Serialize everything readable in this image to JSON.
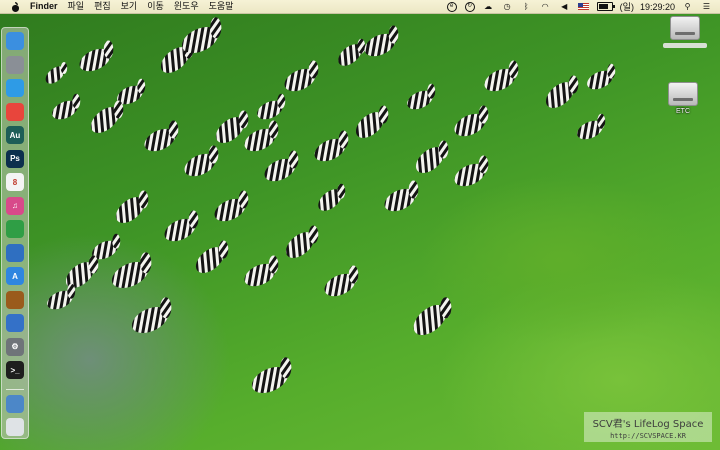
{
  "menubar": {
    "app_name": "Finder",
    "items": [
      "파일",
      "편집",
      "보기",
      "이동",
      "윈도우",
      "도움말"
    ],
    "status": {
      "day": "(일)",
      "time": "19:29:20"
    }
  },
  "desktop": {
    "icons": [
      {
        "label": ""
      },
      {
        "label": "ETC"
      }
    ]
  },
  "dock": {
    "apps": [
      {
        "name": "finder-icon",
        "glyph": "",
        "color": "#3b8fe0"
      },
      {
        "name": "launchpad-icon",
        "glyph": "",
        "color": "#8a8f96"
      },
      {
        "name": "safari-icon",
        "glyph": "",
        "color": "#2e9be6"
      },
      {
        "name": "chrome-icon",
        "glyph": "",
        "color": "#e8453c"
      },
      {
        "name": "audition-icon",
        "glyph": "Au",
        "color": "#1d5e57"
      },
      {
        "name": "photoshop-icon",
        "glyph": "Ps",
        "color": "#0c2f4d"
      },
      {
        "name": "calendar-icon",
        "glyph": "8",
        "color": "#f4f4f4"
      },
      {
        "name": "itunes-icon",
        "glyph": "♫",
        "color": "#d84a8a"
      },
      {
        "name": "evernote-icon",
        "glyph": "",
        "color": "#2f9e45"
      },
      {
        "name": "automator-icon",
        "glyph": "",
        "color": "#2f6fc1"
      },
      {
        "name": "appstore-icon",
        "glyph": "A",
        "color": "#2f86e0"
      },
      {
        "name": "speaker-icon",
        "glyph": "",
        "color": "#9a5b1c"
      },
      {
        "name": "teamviewer-icon",
        "glyph": "",
        "color": "#3471c8"
      },
      {
        "name": "system-preferences-icon",
        "glyph": "⚙",
        "color": "#6f7479"
      },
      {
        "name": "terminal-icon",
        "glyph": ">_",
        "color": "#1e1e1e"
      },
      {
        "name": "downloads-icon",
        "glyph": "",
        "color": "#4c87c8"
      },
      {
        "name": "trash-icon",
        "glyph": "",
        "color": "#dfe3e6"
      }
    ]
  },
  "watermark": {
    "title": "SCV君's LifeLog Space",
    "url": "http://SCVSPACE.KR"
  }
}
